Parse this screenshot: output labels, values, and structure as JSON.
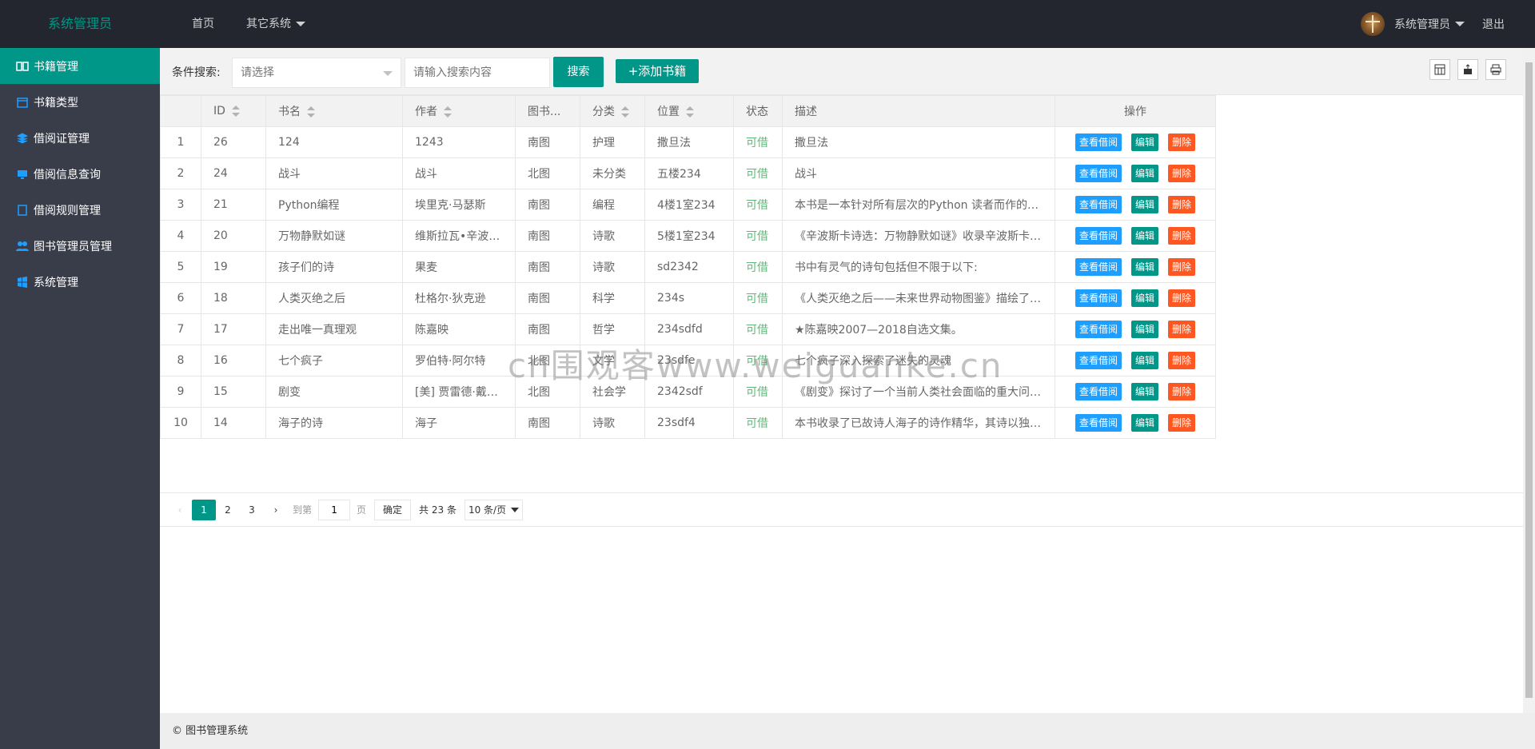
{
  "header": {
    "logo": "系统管理员",
    "nav": [
      {
        "label": "首页"
      },
      {
        "label": "其它系统"
      }
    ],
    "user": "系统管理员",
    "logout": "退出"
  },
  "sidebar": {
    "items": [
      {
        "label": "书籍管理",
        "icon": "book-icon",
        "active": true
      },
      {
        "label": "书籍类型",
        "icon": "calendar-icon"
      },
      {
        "label": "借阅证管理",
        "icon": "layers-icon"
      },
      {
        "label": "借阅信息查询",
        "icon": "monitor-icon"
      },
      {
        "label": "借阅规则管理",
        "icon": "note-icon"
      },
      {
        "label": "图书管理员管理",
        "icon": "users-icon"
      },
      {
        "label": "系统管理",
        "icon": "windows-icon"
      }
    ]
  },
  "toolbar": {
    "condition_label": "条件搜索:",
    "select_placeholder": "请选择",
    "search_placeholder": "请输入搜索内容",
    "search_label": "搜索",
    "add_label": "+添加书籍"
  },
  "table": {
    "headers": [
      "",
      "ID",
      "书名",
      "作者",
      "图书...",
      "分类",
      "位置",
      "状态",
      "描述",
      "操作"
    ],
    "action_labels": {
      "view": "查看借阅",
      "edit": "编辑",
      "delete": "删除"
    },
    "rows": [
      [
        "1",
        "26",
        "124",
        "1243",
        "南图",
        "护理",
        "撒旦法",
        "可借",
        "撒旦法"
      ],
      [
        "2",
        "24",
        "战斗",
        "战斗",
        "北图",
        "未分类",
        "五楼234",
        "可借",
        "战斗"
      ],
      [
        "3",
        "21",
        "Python编程",
        "埃里克·马瑟斯",
        "南图",
        "编程",
        "4楼1室234",
        "可借",
        "本书是一本针对所有层次的Python 读者而作的Python"
      ],
      [
        "4",
        "20",
        "万物静默如谜",
        "维斯拉瓦•辛波斯卡",
        "南图",
        "诗歌",
        "5楼1室234",
        "可借",
        "《辛波斯卡诗选：万物静默如谜》收录辛波斯卡各阶段"
      ],
      [
        "5",
        "19",
        "孩子们的诗",
        "果麦",
        "南图",
        "诗歌",
        "sd2342",
        "可借",
        "书中有灵气的诗句包括但不限于以下:"
      ],
      [
        "6",
        "18",
        "人类灭绝之后",
        "杜格尔·狄克逊",
        "南图",
        "科学",
        "234s",
        "可借",
        "《人类灭绝之后——未来世界动物图鉴》描绘了人类灭"
      ],
      [
        "7",
        "17",
        "走出唯一真理观",
        "陈嘉映",
        "南图",
        "哲学",
        "234sdfd",
        "可借",
        "★陈嘉映2007—2018自选文集。"
      ],
      [
        "8",
        "16",
        "七个疯子",
        "罗伯特·阿尔特",
        "北图",
        "文学",
        "23sdfe",
        "可借",
        "七个疯子深入探索了迷失的灵魂"
      ],
      [
        "9",
        "15",
        "剧变",
        "[美] 贾雷德·戴蒙德",
        "北图",
        "社会学",
        "2342sdf",
        "可借",
        "《剧变》探讨了一个当前人类社会面临的重大问题："
      ],
      [
        "10",
        "14",
        "海子的诗",
        "海子",
        "南图",
        "诗歌",
        "23sdf4",
        "可借",
        "本书收录了已故诗人海子的诗作精华，其诗以独特的"
      ]
    ]
  },
  "pager": {
    "pages": [
      "1",
      "2",
      "3"
    ],
    "current": "1",
    "goto_label": "到第",
    "goto_value": "1",
    "page_unit": "页",
    "confirm": "确定",
    "total": "共 23 条",
    "limit": "10 条/页"
  },
  "footer": "© 图书管理系统",
  "watermark": "cn围观客www.weiguanke.cn",
  "colors": {
    "accent": "#009688",
    "header_bg": "#23262e",
    "sidebar_bg": "#393d49",
    "view": "#1E9FFF",
    "delete": "#FF5722",
    "status": "#5FB878"
  }
}
